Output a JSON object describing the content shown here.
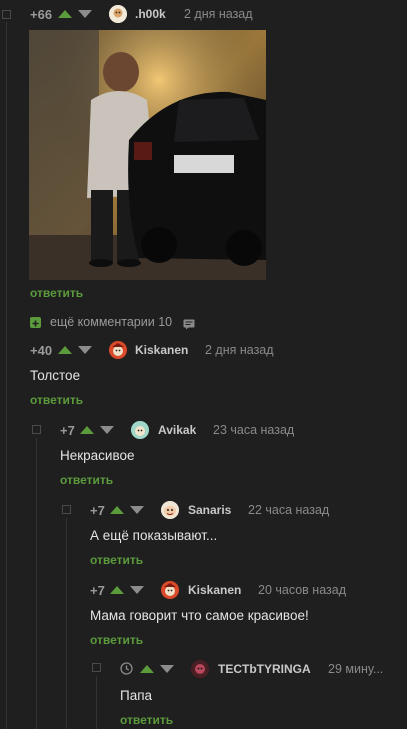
{
  "comments": [
    {
      "rating": "+66",
      "user": ".h00k",
      "time": "2 дня назад",
      "reply": "ответить"
    },
    {
      "rating": "+40",
      "user": "Kiskanen",
      "time": "2 дня назад",
      "text": "Толстое",
      "reply": "ответить"
    },
    {
      "rating": "+7",
      "user": "Avikak",
      "time": "23 часа назад",
      "text": "Некрасивое",
      "reply": "ответить"
    },
    {
      "rating": "+7",
      "user": "Sanaris",
      "time": "22 часа назад",
      "text": "А ещё показывают...",
      "reply": "ответить"
    },
    {
      "rating": "+7",
      "user": "Kiskanen",
      "time": "20 часов назад",
      "text": "Мама говорит что самое красивое!",
      "reply": "ответить"
    },
    {
      "user": "TECTbTYRINGA",
      "time": "29 мину...",
      "text": "Папа",
      "reply": "ответить"
    }
  ],
  "more_comments": "ещё комментарии 10",
  "colors": {
    "accent_green": "#5c9b3c",
    "background": "#1f1f20"
  }
}
